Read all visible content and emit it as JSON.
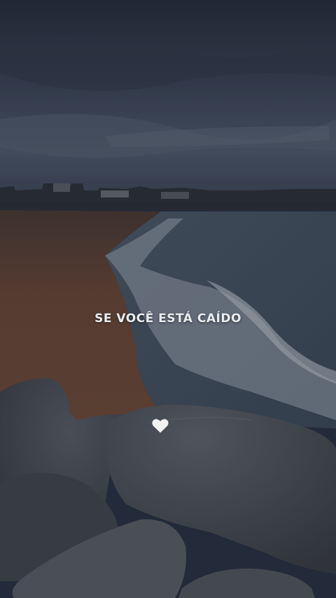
{
  "caption": {
    "text": "SE VOCÊ ESTÁ CAÍDO"
  },
  "overlay_icon": {
    "name": "heart-icon",
    "color": "#f2f2f2"
  },
  "palette": {
    "sky_top": "#2b3444",
    "sky_mid": "#4b5668",
    "sand": "#6b4a38",
    "sea": "#4a5866",
    "foam": "#9aa3ad",
    "rocks": "#4b4f56"
  }
}
